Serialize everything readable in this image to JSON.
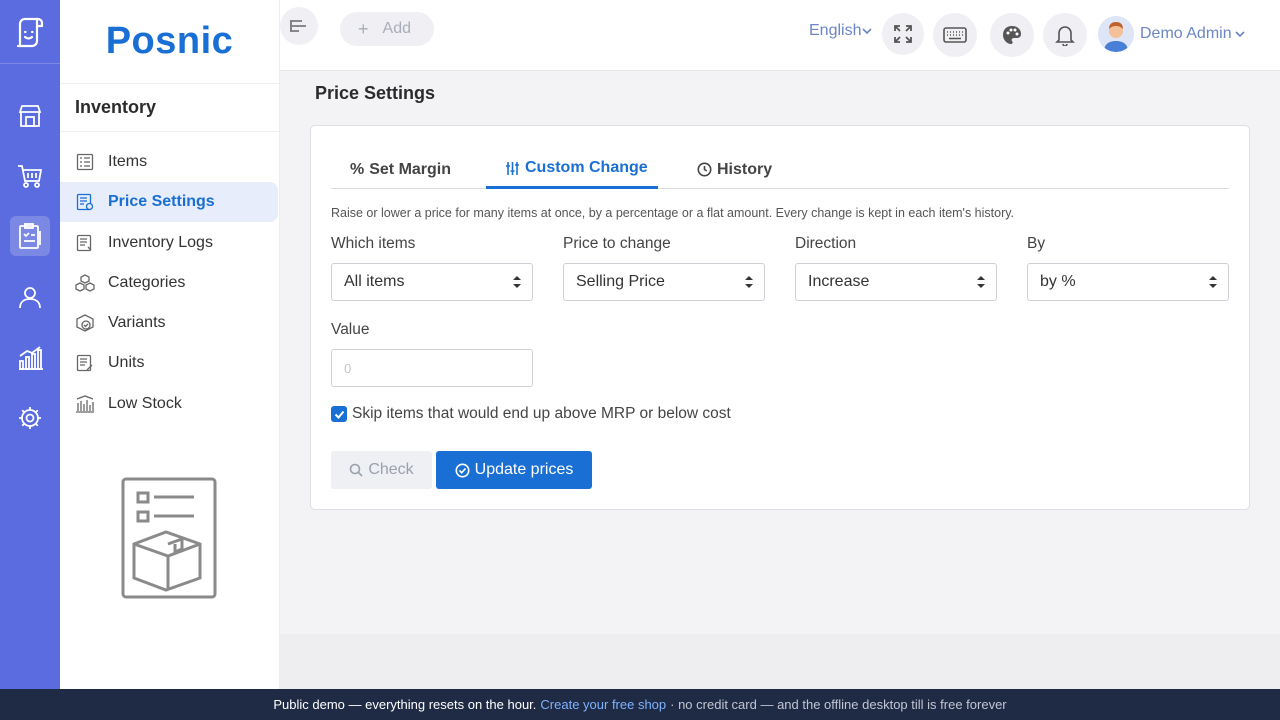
{
  "brand": {
    "name": "Posnic"
  },
  "rail": {
    "items": [
      {
        "icon": "store-icon"
      },
      {
        "icon": "cart-icon"
      },
      {
        "icon": "clipboard-icon",
        "active": true
      },
      {
        "icon": "user-icon"
      },
      {
        "icon": "chart-icon"
      },
      {
        "icon": "gear-icon"
      }
    ]
  },
  "sidebar": {
    "title": "Inventory",
    "items": [
      {
        "label": "Items",
        "icon": "list-icon"
      },
      {
        "label": "Price Settings",
        "icon": "price-doc-icon",
        "active": true
      },
      {
        "label": "Inventory Logs",
        "icon": "log-icon"
      },
      {
        "label": "Categories",
        "icon": "boxes-icon"
      },
      {
        "label": "Variants",
        "icon": "variant-icon"
      },
      {
        "label": "Units",
        "icon": "units-icon"
      },
      {
        "label": "Low Stock",
        "icon": "low-stock-icon"
      }
    ]
  },
  "topbar": {
    "add_label": "Add",
    "language": "English",
    "user_name": "Demo Admin"
  },
  "page": {
    "title": "Price Settings",
    "tabs": [
      {
        "label": "Set Margin",
        "icon": "percent-icon"
      },
      {
        "label": "Custom Change",
        "icon": "sliders-icon",
        "active": true
      },
      {
        "label": "History",
        "icon": "clock-icon"
      }
    ],
    "description": "Raise or lower a price for many items at once, by a percentage or a flat amount. Every change is kept in each item's history.",
    "fields": {
      "which_items": {
        "label": "Which items",
        "value": "All items"
      },
      "price_to_change": {
        "label": "Price to change",
        "value": "Selling Price"
      },
      "direction": {
        "label": "Direction",
        "value": "Increase"
      },
      "by": {
        "label": "By",
        "value": "by %"
      },
      "value": {
        "label": "Value",
        "placeholder": "0"
      }
    },
    "skip_checkbox": {
      "label": "Skip items that would end up above MRP or below cost",
      "checked": true
    },
    "buttons": {
      "check": "Check",
      "update": "Update prices"
    }
  },
  "banner": {
    "lead": "Public demo — everything resets on the hour.",
    "link": "Create your free shop",
    "tail": "· no credit card — and the offline desktop till is free forever"
  },
  "colors": {
    "rail": "#5a6cdf",
    "accent": "#1a6fd4",
    "banner": "#1f2a44"
  }
}
